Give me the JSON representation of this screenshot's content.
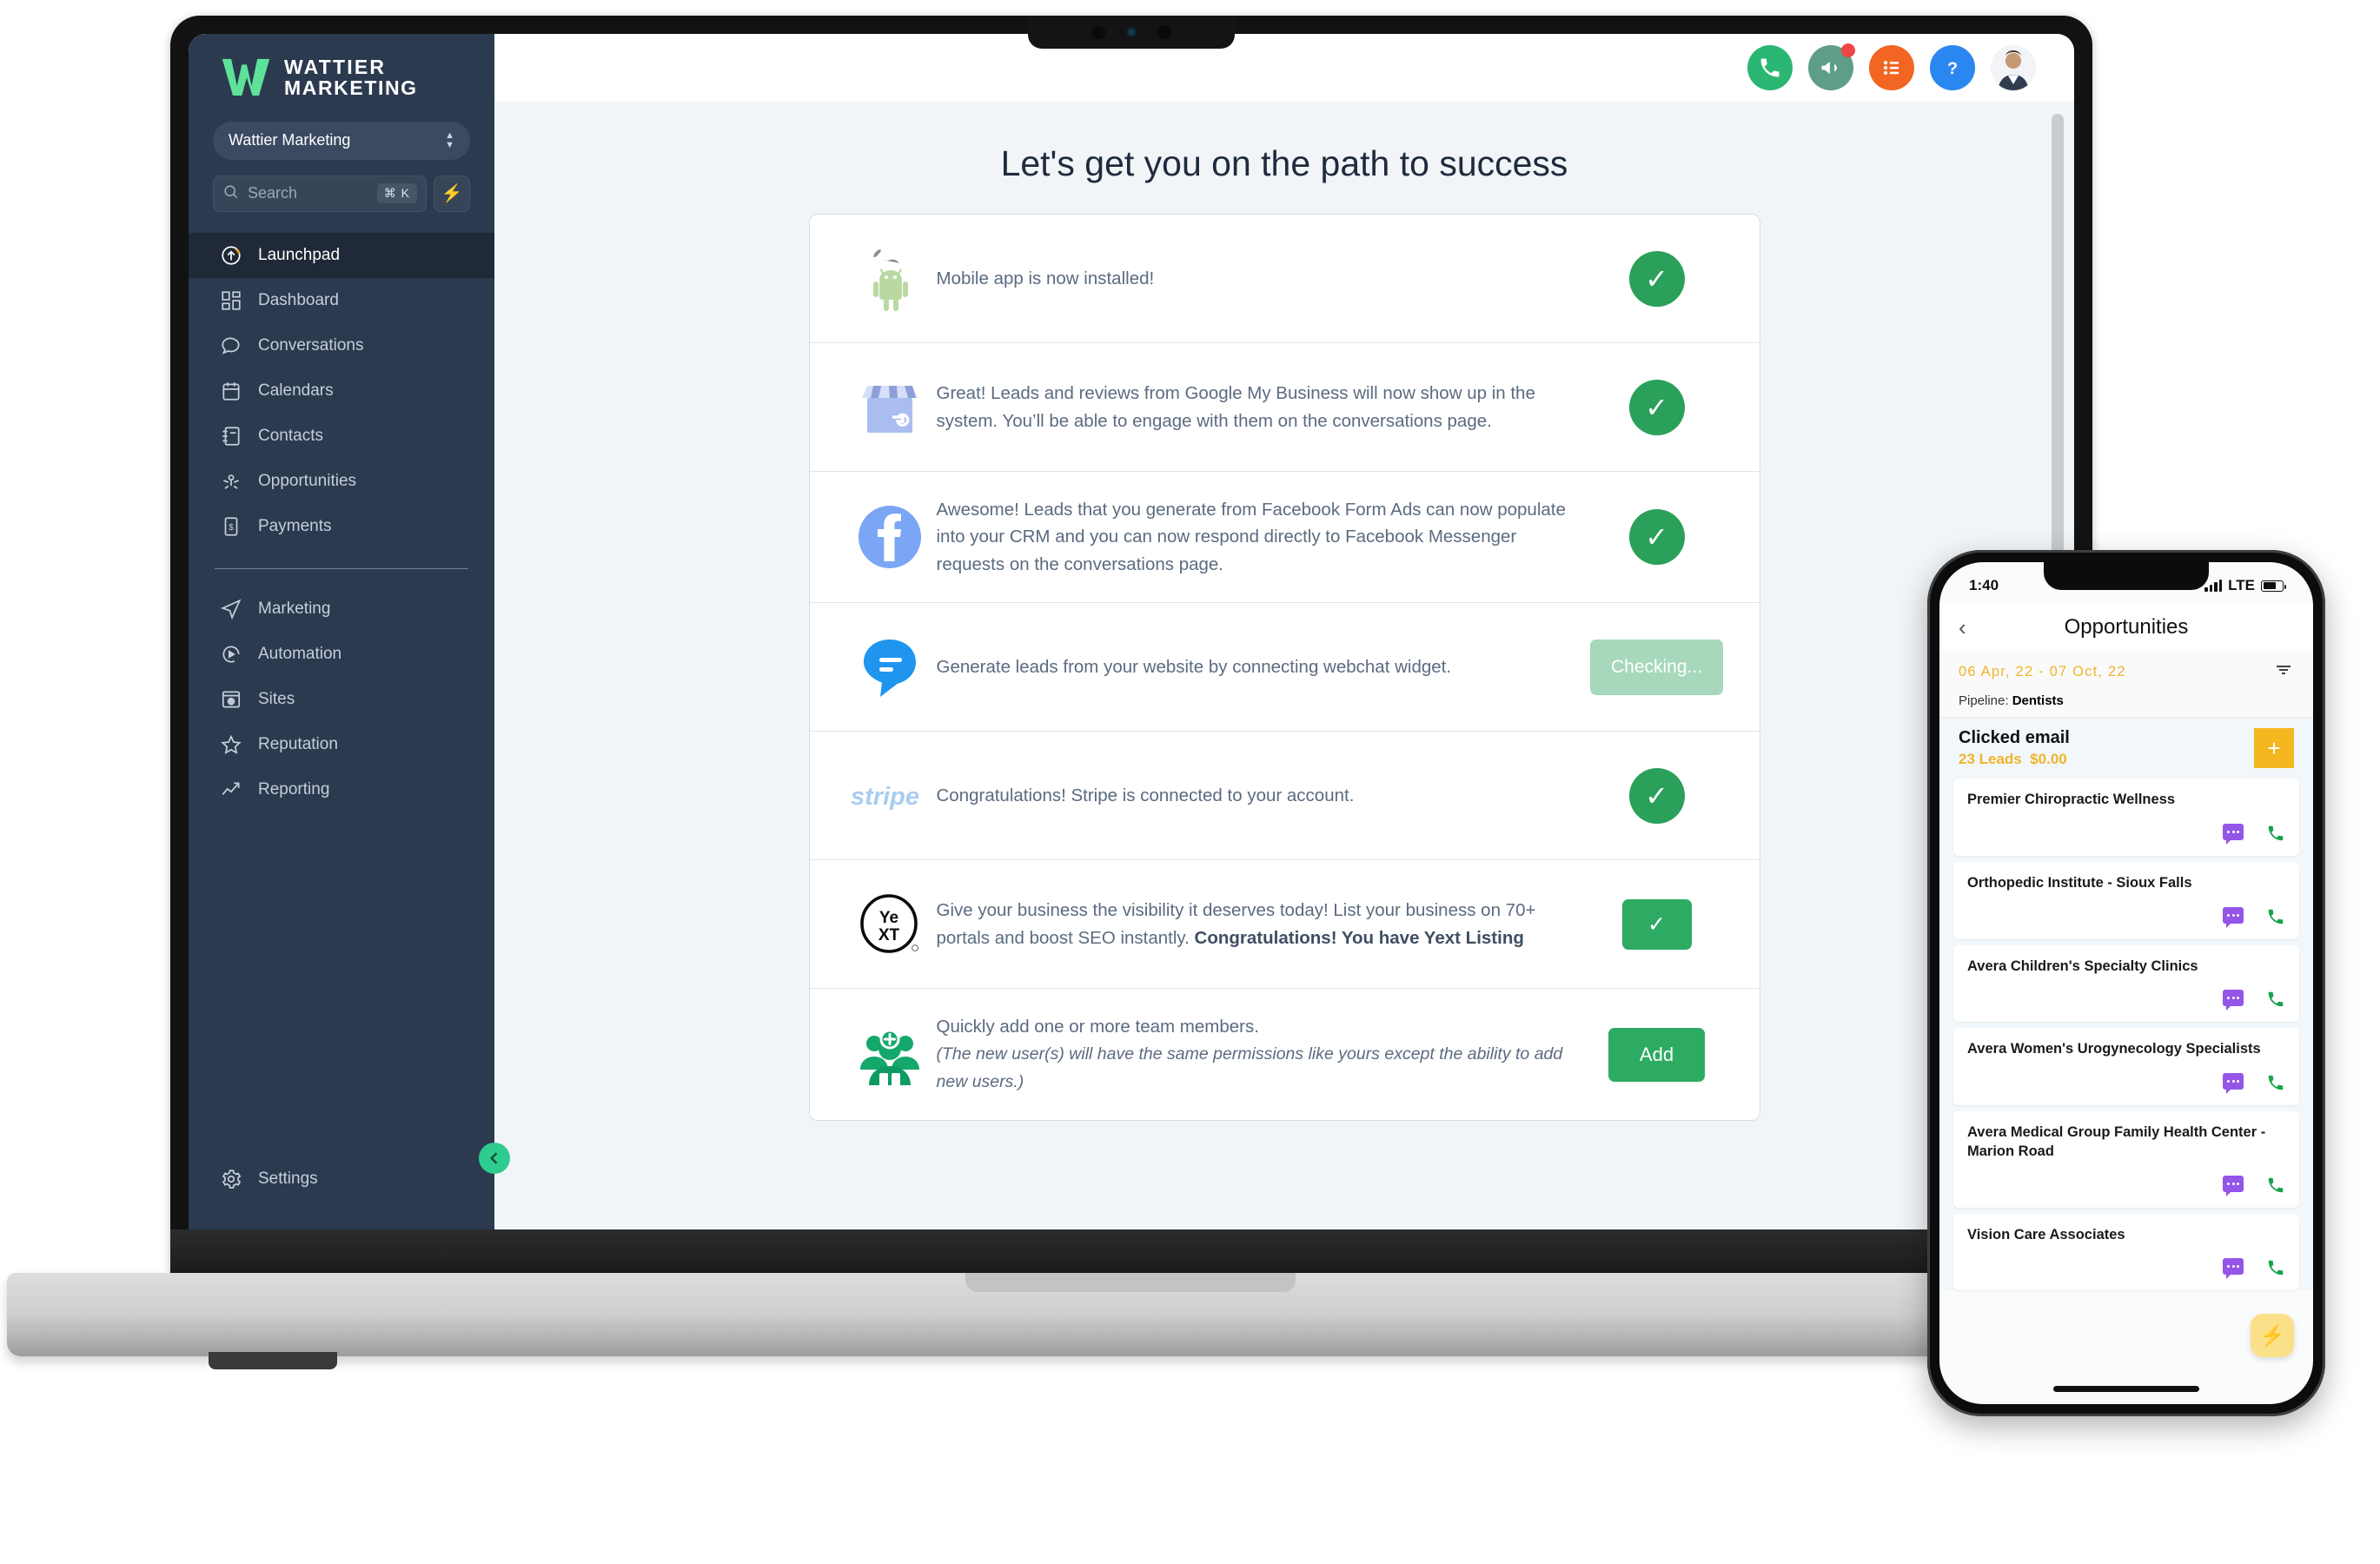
{
  "brand": {
    "line1": "WATTIER",
    "line2": "MARKETING",
    "logo_color": "#5ee29a"
  },
  "sidebar": {
    "account_selector": {
      "label": "Wattier Marketing"
    },
    "search": {
      "placeholder": "Search",
      "shortcut": "⌘ K",
      "bolt_icon": "lightning-icon"
    },
    "items": [
      {
        "label": "Launchpad",
        "icon": "launchpad-icon",
        "active": true
      },
      {
        "label": "Dashboard",
        "icon": "dashboard-grid-icon",
        "active": false
      },
      {
        "label": "Conversations",
        "icon": "chat-bubble-icon",
        "active": false
      },
      {
        "label": "Calendars",
        "icon": "calendar-icon",
        "active": false
      },
      {
        "label": "Contacts",
        "icon": "contacts-book-icon",
        "active": false
      },
      {
        "label": "Opportunities",
        "icon": "opportunities-icon",
        "active": false
      },
      {
        "label": "Payments",
        "icon": "payments-icon",
        "active": false
      }
    ],
    "items2": [
      {
        "label": "Marketing",
        "icon": "paper-plane-icon"
      },
      {
        "label": "Automation",
        "icon": "play-circle-icon"
      },
      {
        "label": "Sites",
        "icon": "browser-window-icon"
      },
      {
        "label": "Reputation",
        "icon": "star-icon"
      },
      {
        "label": "Reporting",
        "icon": "trending-up-icon"
      }
    ],
    "settings": {
      "label": "Settings",
      "icon": "gear-icon"
    },
    "collapse": {
      "icon": "chevron-left-icon"
    }
  },
  "topbar": {
    "icons": [
      {
        "name": "phone-call-icon",
        "color": "#2bb673",
        "badge": false
      },
      {
        "name": "megaphone-icon",
        "color": "#5f9e86",
        "badge": true
      },
      {
        "name": "tasks-list-icon",
        "color": "#f26522",
        "badge": false
      },
      {
        "name": "help-question-icon",
        "color": "#2b87f0",
        "badge": false
      }
    ],
    "avatar": "user-avatar"
  },
  "main": {
    "title": "Let's get you on the path to success",
    "rows": [
      {
        "icon": "apple-android-icon",
        "text": "Mobile app is now installed!",
        "bold": "",
        "italic": "",
        "action": {
          "type": "check-circle",
          "label": "✓"
        }
      },
      {
        "icon": "google-my-business-icon",
        "text": "Great! Leads and reviews from Google My Business will now show up in the system. You’ll be able to engage with them on the conversations page.",
        "bold": "",
        "italic": "",
        "action": {
          "type": "check-circle",
          "label": "✓"
        }
      },
      {
        "icon": "facebook-icon",
        "text": "Awesome! Leads that you generate from Facebook Form Ads can now populate into your CRM and you can now respond directly to Facebook Messenger requests on the conversations page.",
        "bold": "",
        "italic": "",
        "action": {
          "type": "check-circle",
          "label": "✓"
        }
      },
      {
        "icon": "webchat-bubble-icon",
        "text": "Generate leads from your website by connecting webchat widget.",
        "bold": "",
        "italic": "",
        "action": {
          "type": "checking-button",
          "label": "Checking..."
        }
      },
      {
        "icon": "stripe-icon",
        "text": "Congratulations! Stripe is connected to your account.",
        "bold": "",
        "italic": "",
        "action": {
          "type": "check-circle",
          "label": "✓"
        }
      },
      {
        "icon": "yext-icon",
        "text": "Give your business the visibility it deserves today! List your business on 70+ portals and boost SEO instantly.",
        "bold": "Congratulations! You have Yext Listing",
        "italic": "",
        "action": {
          "type": "check-square-button",
          "label": "✓"
        }
      },
      {
        "icon": "add-users-icon",
        "text": "Quickly add one or more team members.",
        "bold": "",
        "italic": "(The new user(s) will have the same permissions like yours except the ability to add new users.)",
        "action": {
          "type": "add-button",
          "label": "Add"
        }
      }
    ]
  },
  "phone": {
    "status": {
      "time": "1:40",
      "network": "LTE"
    },
    "nav": {
      "back_icon": "chevron-left-icon",
      "title": "Opportunities"
    },
    "date_range": "06 Apr, 22 - 07 Oct, 22",
    "filter_icon": "filter-icon",
    "pipeline_label": "Pipeline:",
    "pipeline_value": "Dentists",
    "stage": {
      "name": "Clicked email",
      "leads": "23 Leads",
      "amount": "$0.00",
      "add_label": "+"
    },
    "cards": [
      {
        "name": "Premier Chiropractic Wellness"
      },
      {
        "name": "Orthopedic Institute - Sioux Falls"
      },
      {
        "name": "Avera Children's Specialty Clinics"
      },
      {
        "name": "Avera Women's Urogynecology Specialists"
      },
      {
        "name": "Avera Medical Group Family Health Center - Marion Road"
      },
      {
        "name": "Vision Care Associates"
      }
    ],
    "fab_icon": "lightning-icon"
  },
  "colors": {
    "sidebar_bg": "#2c3a4f",
    "accent_green": "#2eab63",
    "phone_accent": "#f5b720",
    "brand_green": "#5ee29a"
  }
}
